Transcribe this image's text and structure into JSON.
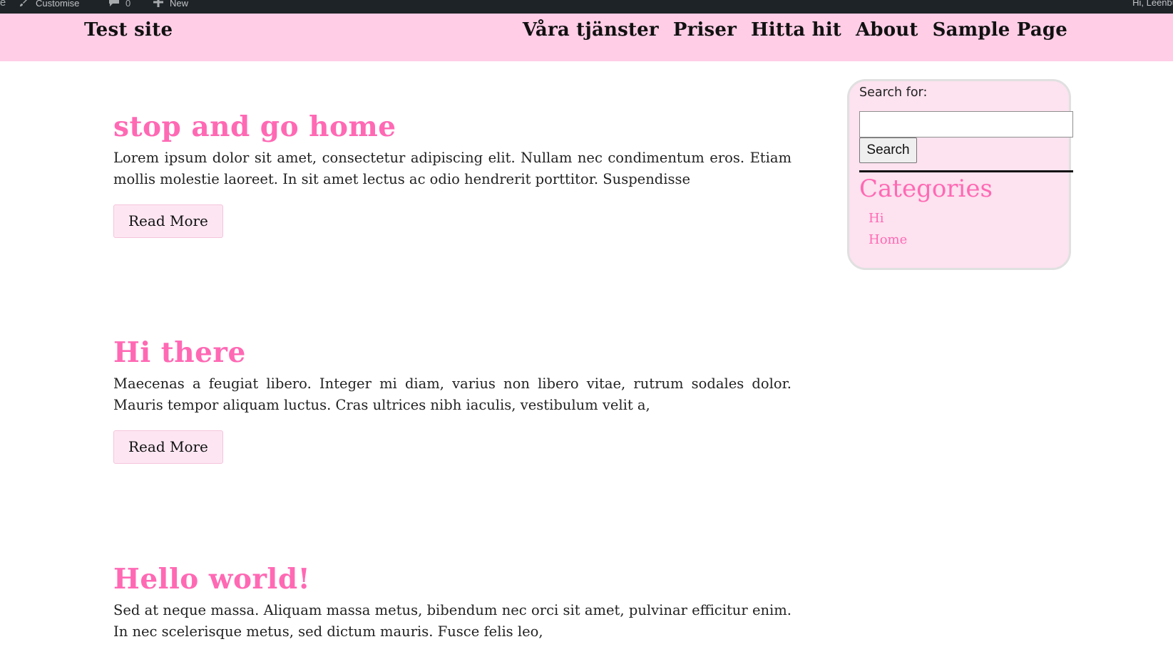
{
  "adminbar": {
    "customise_label": "Customise",
    "comments_count": "0",
    "new_label": "New",
    "greeting": "Hi, Leenbu"
  },
  "header": {
    "site_title": "Test site",
    "nav": [
      {
        "label": "Våra tjänster"
      },
      {
        "label": "Priser"
      },
      {
        "label": "Hitta hit"
      },
      {
        "label": "About"
      },
      {
        "label": "Sample Page"
      }
    ]
  },
  "posts": [
    {
      "title": "stop and go home",
      "excerpt": "Lorem ipsum dolor sit amet, consectetur adipiscing elit. Nullam nec condimentum eros. Etiam mollis molestie laoreet. In sit amet lectus ac odio hendrerit porttitor. Suspendisse",
      "read_more": "Read More"
    },
    {
      "title": "Hi there",
      "excerpt": "Maecenas a feugiat libero. Integer mi diam, varius non libero vitae, rutrum sodales dolor. Mauris tempor aliquam luctus. Cras ultrices nibh iaculis, vestibulum velit a,",
      "read_more": "Read More"
    },
    {
      "title": "Hello world!",
      "excerpt": "Sed at neque massa. Aliquam massa metus, bibendum nec orci sit amet, pulvinar efficitur enim. In nec scelerisque metus, sed dictum mauris. Fusce felis leo,",
      "read_more": ""
    }
  ],
  "sidebar": {
    "search_label": "Search for:",
    "search_value": "",
    "search_button": "Search",
    "categories_title": "Categories",
    "categories": [
      {
        "label": "Hi"
      },
      {
        "label": "Home"
      }
    ]
  },
  "colors": {
    "accent_pink": "#ff69b4",
    "header_bg": "#ffcde6",
    "sidebar_bg": "#fde2ef",
    "adminbar_bg": "#1d2327"
  }
}
